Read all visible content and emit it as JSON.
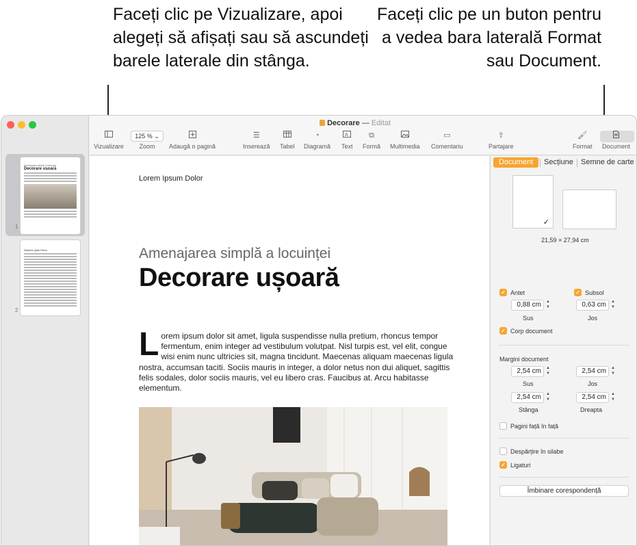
{
  "callouts": {
    "left": "Faceți clic pe Vizualizare, apoi alegeți să afișați sau să ascundeți barele laterale din stânga.",
    "right": "Faceți clic pe un buton pentru a vedea bara laterală Format sau Document."
  },
  "window": {
    "doc_title": "Decorare",
    "doc_status": "Editat",
    "separator": "—"
  },
  "toolbar": {
    "view": "Vizualizare",
    "zoom_value": "125 %",
    "zoom": "Zoom",
    "add_page": "Adaugă o pagină",
    "insert": "Inserează",
    "table": "Tabel",
    "chart": "Diagramă",
    "text": "Text",
    "shape": "Formă",
    "media": "Multimedia",
    "comment": "Comentariu",
    "share": "Partajare",
    "format": "Format",
    "document": "Document"
  },
  "thumbnails": [
    {
      "number": "1",
      "heading": "Decorare ușoară",
      "sub": "Amenajarea simplă a locuinței"
    },
    {
      "number": "2",
      "heading": "Dolores Quis Porro"
    }
  ],
  "document": {
    "header": "Lorem Ipsum Dolor",
    "subtitle": "Amenajarea simplă a locuinței",
    "headline": "Decorare ușoară",
    "dropcap": "L",
    "body": "orem ipsum dolor sit amet, ligula suspendisse nulla pretium, rhoncus tempor fermentum, enim integer ad vestibulum volutpat. Nisl turpis est, vel elit, congue wisi enim nunc ultricies sit, magna tincidunt. Maecenas aliquam maecenas ligula nostra, accumsan taciti. Sociis mauris in integer, a dolor netus non dui aliquet, sagittis felis sodales, dolor sociis mauris, vel eu libero cras. Faucibus at. Arcu habitasse elementum."
  },
  "inspector": {
    "tabs": [
      "Document",
      "Secțiune",
      "Semne de carte"
    ],
    "paper_size": "21,59 × 27,94 cm",
    "header_label": "Antet",
    "footer_label": "Subsol",
    "header_value": "0,88 cm",
    "footer_value": "0,63 cm",
    "top_label": "Sus",
    "bottom_label": "Jos",
    "body_label": "Corp document",
    "margins_title": "Margini document",
    "margin_top": "2,54 cm",
    "margin_bottom": "2,54 cm",
    "margin_left": "2,54 cm",
    "margin_right": "2,54 cm",
    "left_label": "Stânga",
    "right_label": "Dreapta",
    "facing_pages": "Pagini față în față",
    "hyphenation": "Despărțire în silabe",
    "ligatures": "Ligaturi",
    "mail_merge": "Îmbinare corespondență",
    "check_mark": "✓"
  }
}
